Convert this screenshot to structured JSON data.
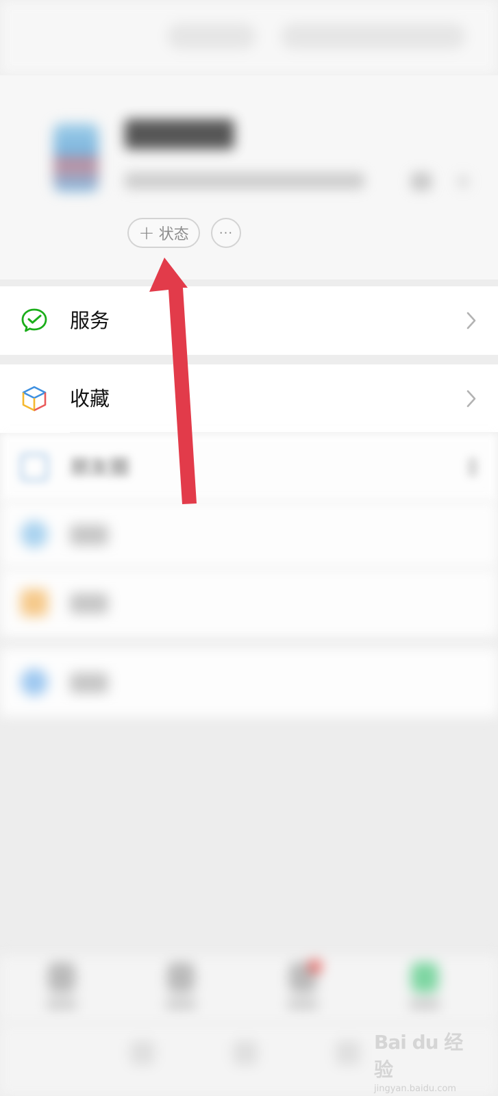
{
  "profile": {
    "status_button_label": "状态",
    "status_button_prefix": "+",
    "more_button_label": "···"
  },
  "menu": {
    "items": [
      {
        "label": "服务",
        "icon": "wechat-pay-icon"
      },
      {
        "label": "收藏",
        "icon": "favorites-cube-icon"
      },
      {
        "label": "朋友圈",
        "icon": "moments-icon"
      },
      {
        "label": "",
        "icon": "video-channel-icon"
      },
      {
        "label": "",
        "icon": "cards-icon"
      },
      {
        "label": "",
        "icon": "settings-icon"
      }
    ]
  },
  "watermark": {
    "logo": "Bai du 经验",
    "sub": "jingyan.baidu.com"
  },
  "colors": {
    "accent_green": "#1aad19",
    "annotation_red": "#e23b4a"
  }
}
